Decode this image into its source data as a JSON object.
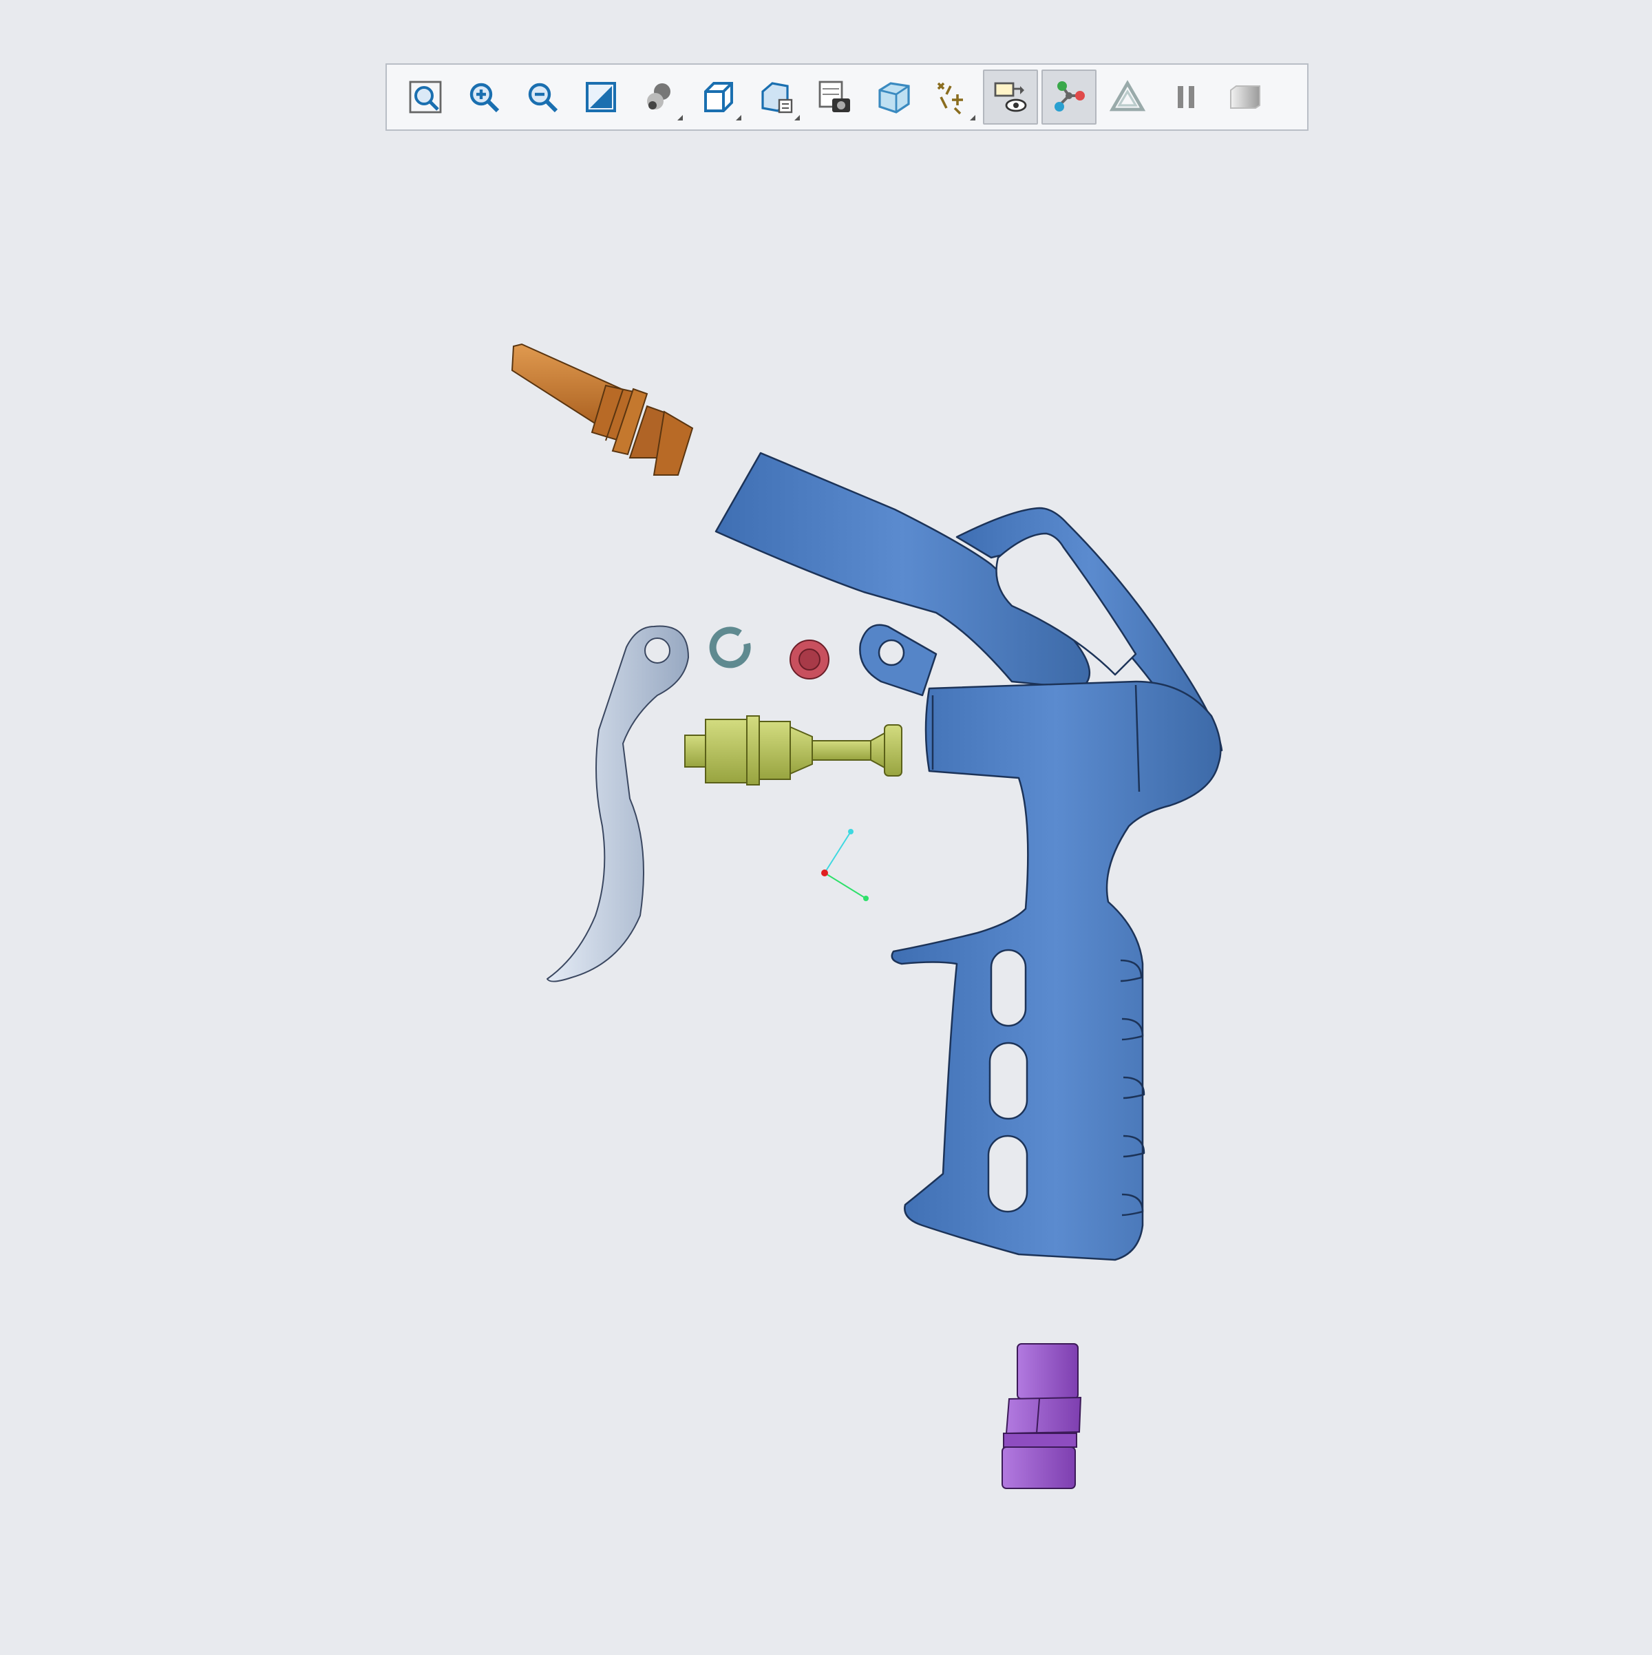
{
  "app": {
    "background": "#e8eaee"
  },
  "toolbar": {
    "buttons": [
      {
        "icon": "zoom-fit-icon",
        "active": false,
        "flyout": false
      },
      {
        "icon": "zoom-in-icon",
        "active": false,
        "flyout": false
      },
      {
        "icon": "zoom-out-icon",
        "active": false,
        "flyout": false
      },
      {
        "icon": "zoom-window-icon",
        "active": false,
        "flyout": false
      },
      {
        "icon": "shading-icon",
        "active": false,
        "flyout": true
      },
      {
        "icon": "saved-views-icon",
        "active": false,
        "flyout": true
      },
      {
        "icon": "view-manager-icon",
        "active": false,
        "flyout": true
      },
      {
        "icon": "snapshot-icon",
        "active": false,
        "flyout": false
      },
      {
        "icon": "perspective-icon",
        "active": false,
        "flyout": false
      },
      {
        "icon": "datum-display-icon",
        "active": false,
        "flyout": true
      },
      {
        "icon": "annotation-display-icon",
        "active": true,
        "flyout": false
      },
      {
        "icon": "explode-view-icon",
        "active": true,
        "flyout": false
      },
      {
        "icon": "spin-center-icon",
        "active": false,
        "flyout": false
      },
      {
        "icon": "pause-icon",
        "active": false,
        "flyout": false
      },
      {
        "icon": "refit-icon",
        "active": false,
        "flyout": false
      }
    ]
  },
  "model": {
    "parts": [
      {
        "name": "nozzle-tip",
        "color": "#c87a30"
      },
      {
        "name": "gun-body",
        "color": "#4f7fc1"
      },
      {
        "name": "trigger-lever",
        "color": "#aab9cf"
      },
      {
        "name": "retaining-clip",
        "color": "#5f8a90"
      },
      {
        "name": "o-ring",
        "color": "#c8505e"
      },
      {
        "name": "valve-stem",
        "color": "#b5c05a"
      },
      {
        "name": "hose-fitting",
        "color": "#9a5bc9"
      }
    ],
    "csys_colors": {
      "x": "#2ee06a",
      "y": "#3ed8e0",
      "origin": "#e02020"
    }
  }
}
